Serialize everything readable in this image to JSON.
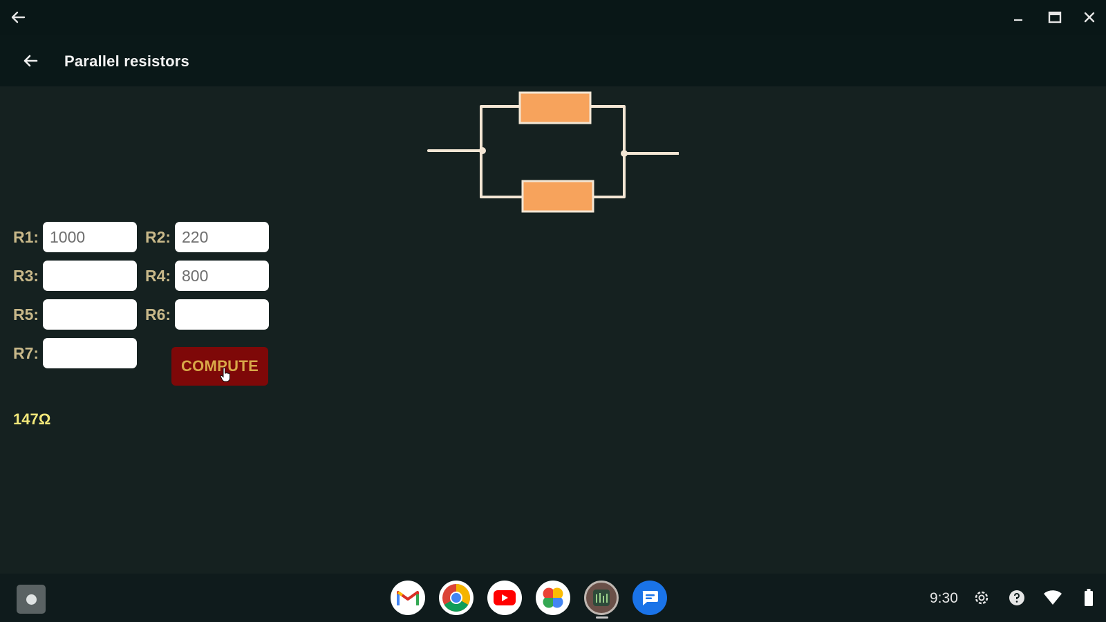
{
  "window": {
    "back_icon": "arrow-left-icon",
    "minimize_icon": "minimize-icon",
    "maximize_icon": "maximize-icon",
    "close_icon": "close-icon"
  },
  "appbar": {
    "title": "Parallel resistors",
    "back_icon": "arrow-left-icon"
  },
  "colors": {
    "resistor": "#f7a35c",
    "wire": "#f3e6d4",
    "compute_bg": "#7e0808",
    "compute_text": "#d8a848",
    "label": "#c9b98a",
    "result": "#f2e87a"
  },
  "form": {
    "fields": [
      {
        "label": "R1:",
        "value": "1000"
      },
      {
        "label": "R2:",
        "value": "220"
      },
      {
        "label": "R3:",
        "value": ""
      },
      {
        "label": "R4:",
        "value": "800"
      },
      {
        "label": "R5:",
        "value": ""
      },
      {
        "label": "R6:",
        "value": ""
      },
      {
        "label": "R7:",
        "value": ""
      }
    ],
    "compute_label": "COMPUTE"
  },
  "result": "147Ω",
  "shelf": {
    "launcher_icon": "launcher-icon",
    "apps": [
      "gmail-icon",
      "chrome-icon",
      "youtube-icon",
      "photos-icon",
      "resistor-app-icon",
      "messages-icon"
    ],
    "time": "9:30",
    "tray_icons": [
      "settings-icon",
      "help-icon",
      "wifi-icon",
      "battery-icon"
    ]
  }
}
